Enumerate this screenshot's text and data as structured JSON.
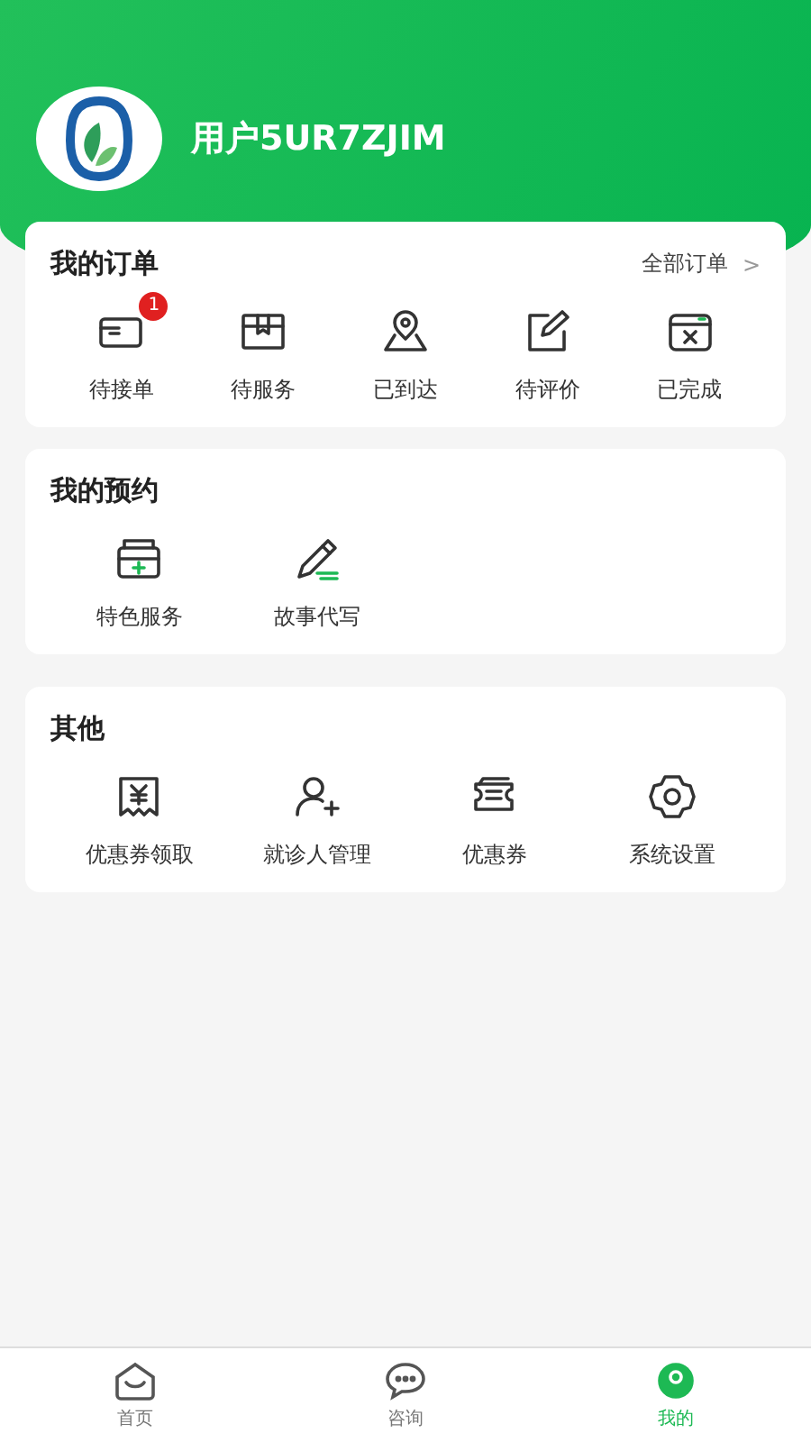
{
  "profile": {
    "username": "用户5UR7ZJIM"
  },
  "orders": {
    "title": "我的订单",
    "link": "全部订单",
    "link_arrow": ">",
    "items": [
      {
        "label": "待接单",
        "badge": "1"
      },
      {
        "label": "待服务"
      },
      {
        "label": "已到达"
      },
      {
        "label": "待评价"
      },
      {
        "label": "已完成"
      }
    ]
  },
  "appointments": {
    "title": "我的预约",
    "items": [
      {
        "label": "特色服务"
      },
      {
        "label": "故事代写"
      }
    ]
  },
  "others": {
    "title": "其他",
    "items": [
      {
        "label": "优惠券领取"
      },
      {
        "label": "就诊人管理"
      },
      {
        "label": "优惠券"
      },
      {
        "label": "系统设置"
      }
    ]
  },
  "tab_bar": [
    {
      "label": "首页",
      "selected": false
    },
    {
      "label": "咨询",
      "selected": false
    },
    {
      "label": "我的",
      "selected": true
    }
  ]
}
